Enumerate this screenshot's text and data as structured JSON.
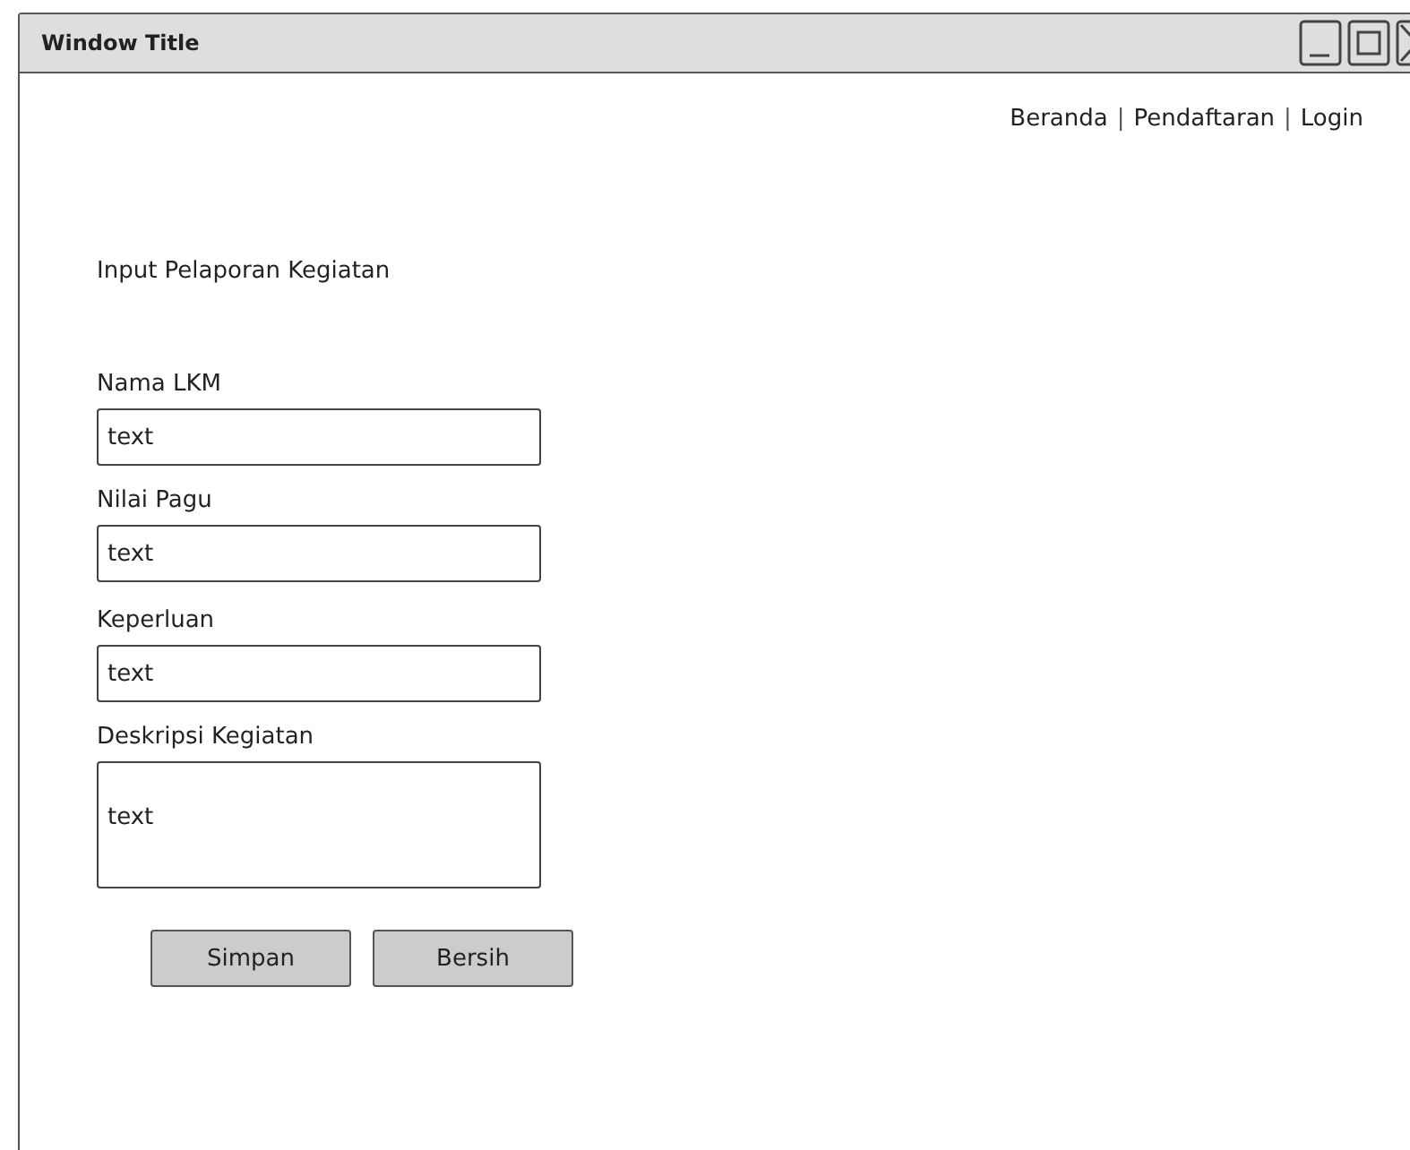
{
  "window": {
    "title": "Window Title",
    "controls": [
      {
        "kind": "minimize"
      },
      {
        "kind": "maximize"
      },
      {
        "kind": "close"
      }
    ]
  },
  "nav": [
    {
      "kind": "link",
      "text": "Beranda"
    },
    {
      "kind": "separator",
      "text": "|"
    },
    {
      "kind": "link",
      "text": "Pendaftaran"
    },
    {
      "kind": "separator",
      "text": "|"
    },
    {
      "kind": "link",
      "text": "Login"
    }
  ],
  "heading": "Input Pelaporan Kegiatan",
  "fields": [
    {
      "kind": "text",
      "label": "Nama LKM",
      "value": "text"
    },
    {
      "kind": "text",
      "label": "Nilai Pagu",
      "value": "text"
    },
    {
      "kind": "text",
      "label": "Keperluan",
      "value": "text"
    },
    {
      "kind": "textarea",
      "label": "Deskripsi Kegiatan",
      "value": "text"
    }
  ],
  "buttons": [
    "Simpan",
    "Bersih"
  ]
}
